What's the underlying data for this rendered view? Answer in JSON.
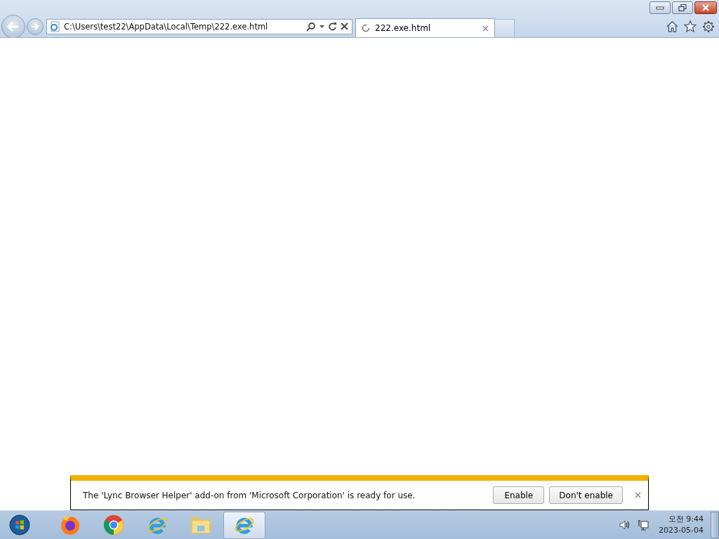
{
  "address_bar": {
    "url": "C:\\Users\\test22\\AppData\\Local\\Temp\\222.exe.html"
  },
  "tabs": [
    {
      "title": "222.exe.html",
      "selected": true,
      "loading": true
    }
  ],
  "notification": {
    "message": "The 'Lync Browser Helper' add-on from 'Microsoft Corporation' is ready for use.",
    "buttons": [
      "Enable",
      "Don't enable"
    ]
  },
  "taskbar": {
    "items": [
      {
        "kind": "firefox",
        "selected": false
      },
      {
        "kind": "chrome",
        "selected": false
      },
      {
        "kind": "ie",
        "selected": false
      },
      {
        "kind": "explorer",
        "selected": false
      },
      {
        "kind": "ie",
        "selected": true
      }
    ],
    "clock": {
      "time": "오전 9:44",
      "date": "2023-05-04"
    }
  }
}
